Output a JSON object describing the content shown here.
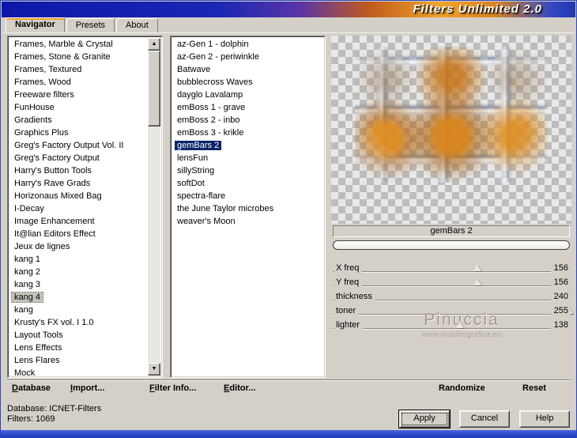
{
  "titlebar": {
    "title": "Filters Unlimited 2.0"
  },
  "tabs": [
    {
      "label": "Navigator",
      "active": true
    },
    {
      "label": "Presets",
      "active": false
    },
    {
      "label": "About",
      "active": false
    }
  ],
  "navigator_list": {
    "selected": "kang 4",
    "items": [
      "Frames, Marble & Crystal",
      "Frames, Stone & Granite",
      "Frames, Textured",
      "Frames, Wood",
      "Freeware filters",
      "FunHouse",
      "Gradients",
      "Graphics Plus",
      "Greg's Factory Output Vol. II",
      "Greg's Factory Output",
      "Harry's Button Tools",
      "Harry's Rave Grads",
      "Horizonaus Mixed Bag",
      "I-Decay",
      "Image Enhancement",
      "It@lian Editors Effect",
      "Jeux de lignes",
      "kang 1",
      "kang 2",
      "kang 3",
      "kang 4",
      "kang",
      "Krusty's FX vol. I 1.0",
      "Layout Tools",
      "Lens Effects",
      "Lens Flares",
      "Mock"
    ]
  },
  "filter_list": {
    "selected": "gemBars 2",
    "items": [
      "az-Gen 1  -  dolphin",
      "az-Gen 2  -  periwinkle",
      "Batwave",
      "bubblecross Waves",
      "dayglo Lavalamp",
      "emBoss 1  -  grave",
      "emBoss 2  -  inbo",
      "emBoss 3  -  krikle",
      "gemBars 2",
      "lensFun",
      "sillyString",
      "softDot",
      "spectra-flare",
      "the June Taylor microbes",
      "weaver's Moon"
    ]
  },
  "preview": {
    "filter_name": "gemBars 2",
    "watermark": "Pinuccia",
    "watermark_url": "www.maidiregrafica.eu"
  },
  "sliders": {
    "max": 255,
    "items": [
      {
        "label": "X freq",
        "value": 156
      },
      {
        "label": "Y freq",
        "value": 156
      },
      {
        "label": "thickness",
        "value": 240
      },
      {
        "label": "toner",
        "value": 255
      },
      {
        "label": "lighter",
        "value": 138
      }
    ]
  },
  "toolbar": {
    "database": "Database",
    "import": "Import...",
    "filter_info": "Filter Info...",
    "editor": "Editor...",
    "randomize": "Randomize",
    "reset": "Reset"
  },
  "status": {
    "database": "Database:  ICNET-Filters",
    "filters": "Filters:    1069"
  },
  "action_buttons": {
    "apply": "Apply",
    "cancel": "Cancel",
    "help": "Help"
  },
  "colors": {
    "selection": "#0a246a",
    "dialog_gray": "#d4d0c8",
    "titlebar_blue": "#1a27b4",
    "titlebar_orange": "#f0a42c",
    "tab_accent": "#f0a028"
  }
}
